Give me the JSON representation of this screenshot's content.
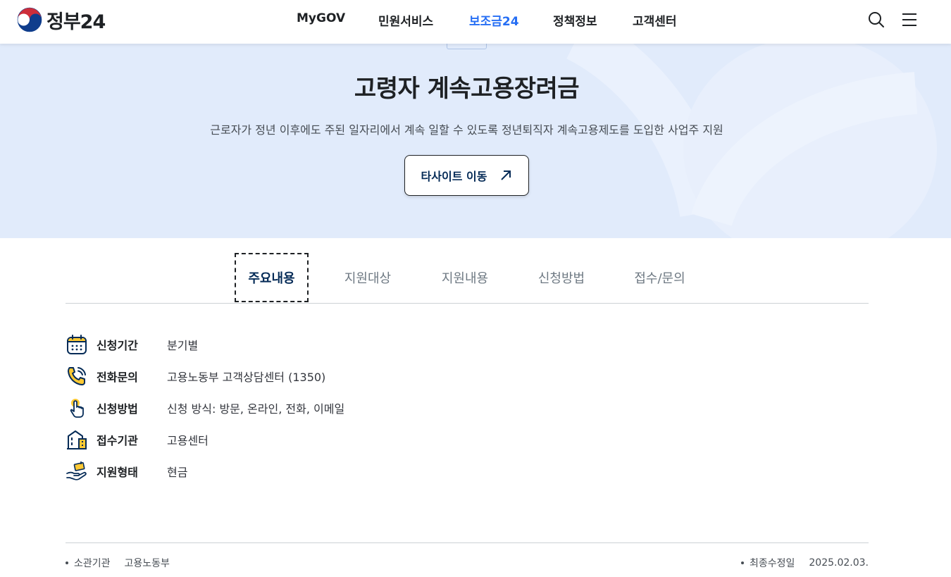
{
  "header": {
    "logo_text": "정부24",
    "nav": [
      "MyGOV",
      "민원서비스",
      "보조금24",
      "정책정보",
      "고객센터"
    ],
    "active_nav": "보조금24",
    "search_icon": "search-icon",
    "menu_icon": "hamburger-menu-icon"
  },
  "hero": {
    "title": "고령자 계속고용장려금",
    "description": "근로자가 정년 이후에도 주된 일자리에서 계속 일할 수 있도록 정년퇴직자 계속고용제도를 도입한 사업주 지원",
    "button_label": "타사이트 이동",
    "button_icon": "arrow-up-right-icon"
  },
  "tabs": [
    "주요내용",
    "지원대상",
    "지원내용",
    "신청방법",
    "접수/문의"
  ],
  "active_tab": "주요내용",
  "info": [
    {
      "icon": "calendar-icon",
      "label": "신청기간",
      "value": "분기별"
    },
    {
      "icon": "phone-icon",
      "label": "전화문의",
      "value": "고용노동부 고객상담센터 (1350)"
    },
    {
      "icon": "touch-hand-icon",
      "label": "신청방법",
      "value": "신청 방식: 방문, 온라인, 전화, 이메일"
    },
    {
      "icon": "building-icon",
      "label": "접수기관",
      "value": "고용센터"
    },
    {
      "icon": "hand-money-icon",
      "label": "지원형태",
      "value": "현금"
    }
  ],
  "meta": {
    "agency_label": "소관기관",
    "agency_value": "고용노동부",
    "updated_label": "최종수정일",
    "updated_value": "2025.02.03."
  },
  "colors": {
    "accent": "#256ef4",
    "hero_bg": "#e1ebfb",
    "navy": "#052b57",
    "icon_yellow": "#ffc933"
  }
}
